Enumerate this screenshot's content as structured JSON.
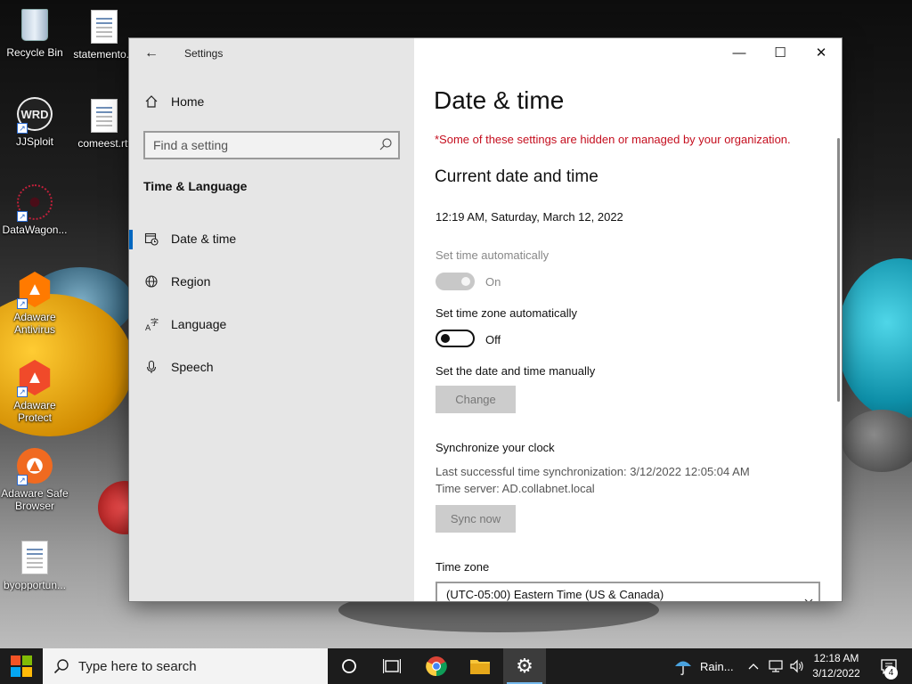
{
  "desktop": {
    "icons": [
      {
        "label": "Recycle Bin"
      },
      {
        "label": "statemento..."
      },
      {
        "label": "JJSploit"
      },
      {
        "label": "comeest.rtf"
      },
      {
        "label": "DataWagon..."
      },
      {
        "label": "Adaware Antivirus"
      },
      {
        "label": "Adaware Protect"
      },
      {
        "label": "Adaware Safe Browser"
      },
      {
        "label": "byopportun..."
      }
    ],
    "jjsploit_logo_text": "WRD"
  },
  "window": {
    "title": "Settings",
    "controls": {
      "minimize": "—",
      "maximize": "☐",
      "close": "✕"
    }
  },
  "sidebar": {
    "home_label": "Home",
    "search_placeholder": "Find a setting",
    "section_title": "Time & Language",
    "items": [
      {
        "label": "Date & time",
        "icon": "calendar-clock-icon",
        "active": true
      },
      {
        "label": "Region",
        "icon": "globe-icon",
        "active": false
      },
      {
        "label": "Language",
        "icon": "language-icon",
        "active": false
      },
      {
        "label": "Speech",
        "icon": "microphone-icon",
        "active": false
      }
    ]
  },
  "content": {
    "page_title": "Date & time",
    "managed_notice": "*Some of these settings are hidden or managed by your organization.",
    "current_heading": "Current date and time",
    "current_datetime": "12:19 AM, Saturday, March 12, 2022",
    "set_time_auto": {
      "label": "Set time automatically",
      "state": "On",
      "enabled": false
    },
    "set_tz_auto": {
      "label": "Set time zone automatically",
      "state": "Off",
      "enabled": true
    },
    "manual_label": "Set the date and time manually",
    "change_button": "Change",
    "sync_heading": "Synchronize your clock",
    "last_sync": "Last successful time synchronization: 3/12/2022 12:05:04 AM",
    "time_server": "Time server: AD.collabnet.local",
    "sync_button": "Sync now",
    "timezone_label": "Time zone",
    "timezone_value": "(UTC-05:00) Eastern Time (US & Canada)"
  },
  "taskbar": {
    "search_placeholder": "Type here to search",
    "weather": "Rain...",
    "time": "12:18 AM",
    "date": "3/12/2022",
    "notification_count": "4"
  },
  "colors": {
    "accent": "#0067c0",
    "warning": "#c50f1f",
    "sidebar_bg": "#e6e6e6",
    "taskbar_bg": "#1c1c1c"
  }
}
